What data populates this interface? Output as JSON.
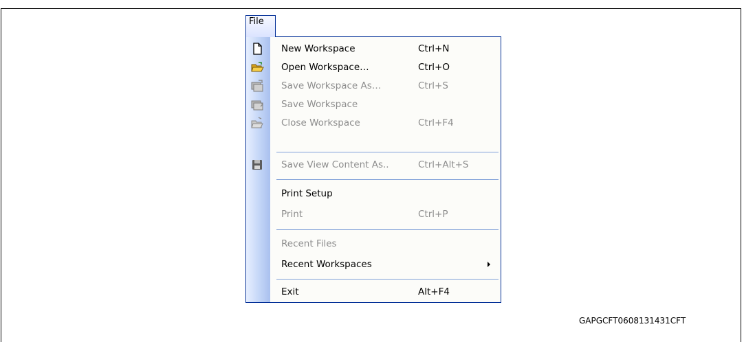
{
  "menu_bar": {
    "file_label": "File"
  },
  "menu": {
    "items": [
      {
        "label": "New Workspace",
        "shortcut": "Ctrl+N",
        "icon": "new-document-icon",
        "enabled": true
      },
      {
        "label": "Open Workspace…",
        "shortcut": "Ctrl+O",
        "icon": "open-folder-icon",
        "enabled": true
      },
      {
        "label": "Save Workspace As…",
        "shortcut": "Ctrl+S",
        "icon": "save-workspace-as-icon",
        "enabled": false
      },
      {
        "label": "Save Workspace",
        "shortcut": "",
        "icon": "save-workspace-icon",
        "enabled": false
      },
      {
        "label": "Close Workspace",
        "shortcut": "Ctrl+F4",
        "icon": "close-workspace-icon",
        "enabled": false
      },
      {
        "label": "Save View Content As..",
        "shortcut": "Ctrl+Alt+S",
        "icon": "floppy-disk-icon",
        "enabled": false
      },
      {
        "label": "Print Setup",
        "shortcut": "",
        "icon": "",
        "enabled": true
      },
      {
        "label": "Print",
        "shortcut": "Ctrl+P",
        "icon": "",
        "enabled": false
      },
      {
        "label": "Recent Files",
        "shortcut": "",
        "icon": "",
        "enabled": false
      },
      {
        "label": "Recent Workspaces",
        "shortcut": "",
        "icon": "submenu-arrow-icon",
        "enabled": true
      },
      {
        "label": "Exit",
        "shortcut": "Alt+F4",
        "icon": "",
        "enabled": true
      }
    ]
  },
  "colors": {
    "menu_border": "#002d96",
    "separator": "#7e9fd8",
    "disabled_text": "#8d8d8d",
    "gutter": "#c4d6f7"
  },
  "figure_id": "GAPGCFT0608131431CFT"
}
